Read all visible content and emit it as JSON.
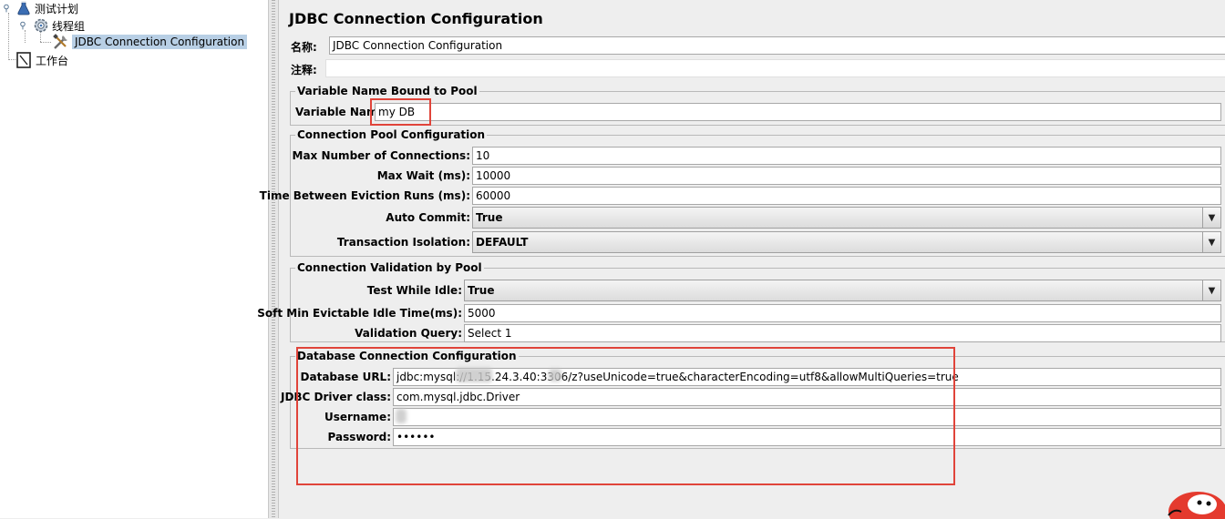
{
  "tree": {
    "root": "测试计划",
    "thread_group": "线程组",
    "selected": "JDBC Connection Configuration",
    "workbench": "工作台"
  },
  "panel": {
    "title": "JDBC Connection Configuration",
    "name_label": "名称:",
    "name_value": "JDBC Connection Configuration",
    "comment_label": "注释:",
    "comment_value": ""
  },
  "var_section": {
    "legend": "Variable Name Bound to Pool",
    "label": "Variable Name:",
    "value": "my DB"
  },
  "pool_section": {
    "legend": "Connection Pool Configuration",
    "max_conn_label": "Max Number of Connections:",
    "max_conn_value": "10",
    "max_wait_label": "Max Wait (ms):",
    "max_wait_value": "10000",
    "eviction_label": "Time Between Eviction Runs (ms):",
    "eviction_value": "60000",
    "auto_commit_label": "Auto Commit:",
    "auto_commit_value": "True",
    "isolation_label": "Transaction Isolation:",
    "isolation_value": "DEFAULT"
  },
  "validation_section": {
    "legend": "Connection Validation by Pool",
    "test_idle_label": "Test While Idle:",
    "test_idle_value": "True",
    "soft_min_label": "Soft Min Evictable Idle Time(ms):",
    "soft_min_value": "5000",
    "query_label": "Validation Query:",
    "query_value": "Select 1"
  },
  "db_section": {
    "legend": "Database Connection Configuration",
    "url_label": "Database URL:",
    "url_value": "jdbc:mysql://1.15.24.3.40:3306/z?useUnicode=true&characterEncoding=utf8&allowMultiQueries=true",
    "driver_label": "JDBC Driver class:",
    "driver_value": "com.mysql.jdbc.Driver",
    "user_label": "Username:",
    "user_value": "",
    "pass_label": "Password:",
    "pass_value": "••••••"
  },
  "colors": {
    "highlight": "#e0443a",
    "selection": "#b8cfe5",
    "panel_bg": "#eeeeee"
  }
}
